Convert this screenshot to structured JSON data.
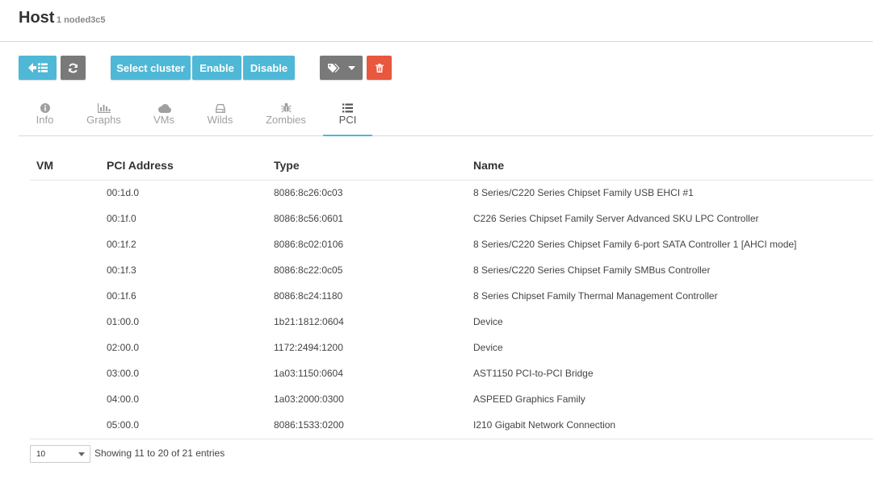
{
  "header": {
    "title": "Host",
    "subtitle": "1 noded3c5"
  },
  "toolbar": {
    "back_icon": "arrow-left-list-icon",
    "refresh_icon": "refresh-icon",
    "select_cluster_label": "Select cluster",
    "enable_label": "Enable",
    "disable_label": "Disable",
    "tags_icon": "tags-icon",
    "delete_icon": "trash-icon",
    "colors": {
      "info": "#4fb8d6",
      "grey": "#797979",
      "danger": "#e9573f"
    }
  },
  "tabs": [
    {
      "label": "Info",
      "icon": "info-circle-icon",
      "active": false
    },
    {
      "label": "Graphs",
      "icon": "bar-chart-icon",
      "active": false
    },
    {
      "label": "VMs",
      "icon": "cloud-icon",
      "active": false
    },
    {
      "label": "Wilds",
      "icon": "hdd-icon",
      "active": false
    },
    {
      "label": "Zombies",
      "icon": "bug-icon",
      "active": false
    },
    {
      "label": "PCI",
      "icon": "list-icon",
      "active": true
    }
  ],
  "table": {
    "columns": [
      "VM",
      "PCI Address",
      "Type",
      "Name"
    ],
    "rows": [
      {
        "vm": "",
        "address": "00:1d.0",
        "type": "8086:8c26:0c03",
        "name": "8 Series/C220 Series Chipset Family USB EHCI #1"
      },
      {
        "vm": "",
        "address": "00:1f.0",
        "type": "8086:8c56:0601",
        "name": "C226 Series Chipset Family Server Advanced SKU LPC Controller"
      },
      {
        "vm": "",
        "address": "00:1f.2",
        "type": "8086:8c02:0106",
        "name": "8 Series/C220 Series Chipset Family 6-port SATA Controller 1 [AHCI mode]"
      },
      {
        "vm": "",
        "address": "00:1f.3",
        "type": "8086:8c22:0c05",
        "name": "8 Series/C220 Series Chipset Family SMBus Controller"
      },
      {
        "vm": "",
        "address": "00:1f.6",
        "type": "8086:8c24:1180",
        "name": "8 Series Chipset Family Thermal Management Controller"
      },
      {
        "vm": "",
        "address": "01:00.0",
        "type": "1b21:1812:0604",
        "name": "Device"
      },
      {
        "vm": "",
        "address": "02:00.0",
        "type": "1172:2494:1200",
        "name": "Device"
      },
      {
        "vm": "",
        "address": "03:00.0",
        "type": "1a03:1150:0604",
        "name": "AST1150 PCI-to-PCI Bridge"
      },
      {
        "vm": "",
        "address": "04:00.0",
        "type": "1a03:2000:0300",
        "name": "ASPEED Graphics Family"
      },
      {
        "vm": "",
        "address": "05:00.0",
        "type": "8086:1533:0200",
        "name": "I210 Gigabit Network Connection"
      }
    ]
  },
  "footer": {
    "page_size": "10",
    "showing": "Showing 11 to 20 of 21 entries"
  }
}
